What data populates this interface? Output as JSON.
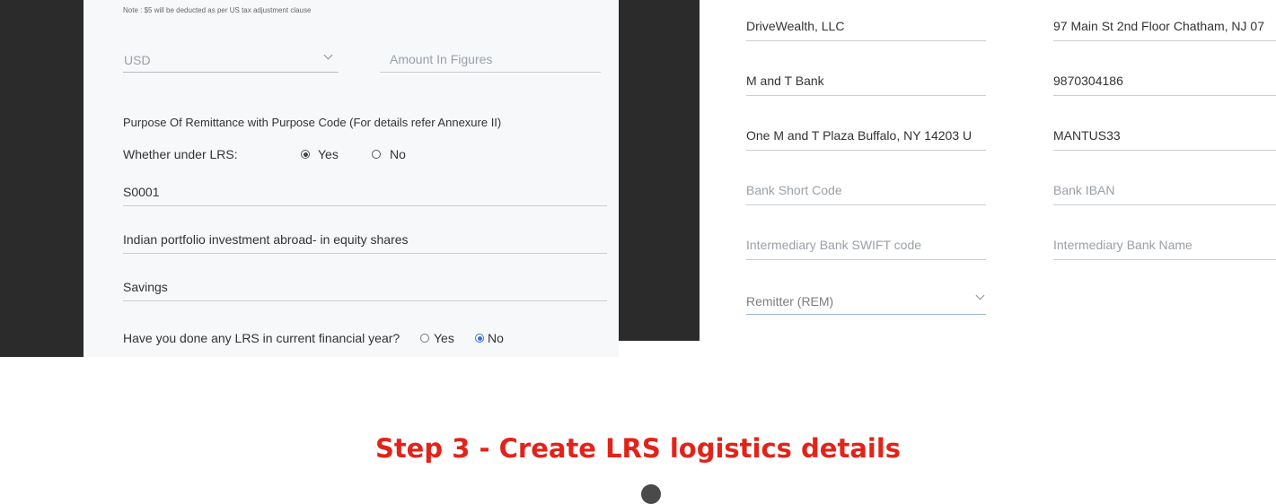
{
  "left_form": {
    "note": "Note : $5 will be deducted as per US tax adjustment clause",
    "currency": {
      "value": "USD"
    },
    "amount": {
      "placeholder": "Amount In Figures"
    },
    "purpose_heading": "Purpose Of Remittance with Purpose Code (For details refer Annexure II)",
    "lrs_question": {
      "label": "Whether under LRS:",
      "options": [
        {
          "label": "Yes",
          "selected": true
        },
        {
          "label": "No",
          "selected": false
        }
      ]
    },
    "purpose_code": "S0001",
    "purpose_description": "Indian portfolio investment abroad- in equity shares",
    "account_type": "Savings",
    "lrs_current_year": {
      "label": "Have you done any LRS in current financial year?",
      "options": [
        {
          "label": "Yes",
          "selected": false
        },
        {
          "label": "No",
          "selected": true
        }
      ]
    }
  },
  "right_form": {
    "beneficiary_name": "DriveWealth, LLC",
    "beneficiary_address": "97 Main St 2nd Floor Chatham, NJ 07",
    "bank_name": "M and T Bank",
    "account_number": "9870304186",
    "bank_address": "One M and T Plaza Buffalo, NY 14203 U",
    "swift_code": "MANTUS33",
    "bank_short_code": {
      "placeholder": "Bank Short Code"
    },
    "bank_iban": {
      "placeholder": "Bank IBAN"
    },
    "intermediary_swift": {
      "placeholder": "Intermediary Bank SWIFT code"
    },
    "intermediary_name": {
      "placeholder": "Intermediary Bank Name"
    },
    "charges": {
      "value": "Remitter (REM)"
    }
  },
  "step": {
    "title": "Step 3 - Create LRS logistics details"
  },
  "colors": {
    "step_title": "#e2231a",
    "radio_blue": "#3b6ee6",
    "dark_band": "#2b2b2b"
  }
}
